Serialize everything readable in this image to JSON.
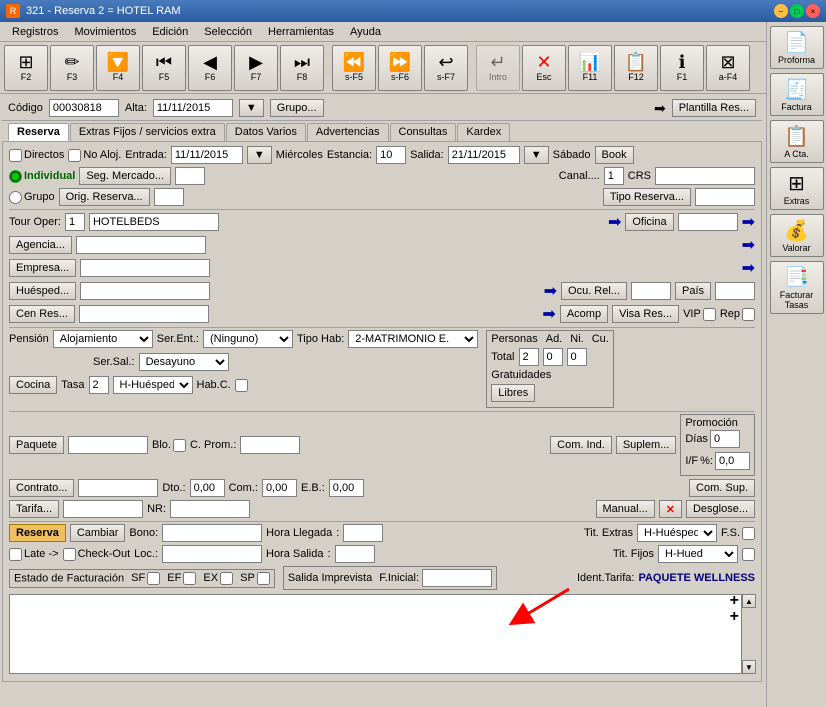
{
  "titlebar": {
    "title": "321 - Reserva   2 = HOTEL RAM",
    "icon": "R"
  },
  "menubar": {
    "items": [
      "Registros",
      "Movimientos",
      "Edición",
      "Selección",
      "Herramientas",
      "Ayuda"
    ]
  },
  "toolbar": {
    "buttons": [
      {
        "id": "F2",
        "icon": "⊞",
        "label": "F2"
      },
      {
        "id": "F3",
        "icon": "✏",
        "label": "F3"
      },
      {
        "id": "F4",
        "icon": "▼",
        "label": "F4"
      },
      {
        "id": "F5",
        "icon": "◀",
        "label": "F5"
      },
      {
        "id": "F6",
        "icon": "◀",
        "label": "F6"
      },
      {
        "id": "F7",
        "icon": "▶",
        "label": "F7"
      },
      {
        "id": "F8",
        "icon": "▶▶",
        "label": "F8"
      },
      {
        "id": "s-F5",
        "icon": "◀|",
        "label": "s-F5"
      },
      {
        "id": "s-F6",
        "icon": "|◀",
        "label": "s-F6"
      },
      {
        "id": "s-F7",
        "icon": "↵",
        "label": "s-F7"
      },
      {
        "id": "Intro",
        "icon": "↩",
        "label": "Intro"
      },
      {
        "id": "Esc",
        "icon": "✕",
        "label": "Esc"
      },
      {
        "id": "F11",
        "icon": "⊟",
        "label": "F11"
      },
      {
        "id": "F12",
        "icon": "⊞",
        "label": "F12"
      },
      {
        "id": "F1",
        "icon": "ℹ",
        "label": "F1"
      },
      {
        "id": "a-F4",
        "icon": "⊠",
        "label": "a-F4"
      }
    ]
  },
  "codebar": {
    "codigo_label": "Código",
    "codigo_value": "00030818",
    "alta_label": "Alta:",
    "alta_value": "11/11/2015",
    "grupo_label": "Grupo...",
    "plantilla_label": "Plantilla Res..."
  },
  "tabs": {
    "items": [
      "Reserva",
      "Extras Fijos / servicios extra",
      "Datos Varios",
      "Advertencias",
      "Consultas",
      "Kardex"
    ],
    "active": 0
  },
  "reservation": {
    "directos_label": "Directos",
    "no_aloj_label": "No Aloj.",
    "entrada_label": "Entrada:",
    "entrada_value": "11/11/2015",
    "miercoles_label": "Miércoles",
    "estancia_label": "Estancia:",
    "estancia_value": "10",
    "salida_label": "Salida:",
    "salida_value": "21/11/2015",
    "sabado_label": "Sábado",
    "book_label": "Book",
    "individual_label": "Individual",
    "grupo_label": "Grupo",
    "seg_mercado_label": "Seg. Mercado...",
    "orig_reserva_label": "Orig. Reserva...",
    "canal_label": "Canal....",
    "canal_value": "1",
    "crs_label": "CRS",
    "tipo_reserva_label": "Tipo Reserva...",
    "tour_oper_label": "Tour Oper:",
    "tour_oper_value": "1",
    "hotelbeds_label": "HOTELBEDS",
    "agencia_label": "Agencia...",
    "empresa_label": "Empresa...",
    "huesped_label": "Huésped...",
    "ocu_rel_label": "Ocu. Rel...",
    "pais_label": "País",
    "cen_res_label": "Cen Res...",
    "acomp_label": "Acomp",
    "visa_res_label": "Visa Res...",
    "vip_label": "VIP",
    "rep_label": "Rep",
    "pension_label": "Pensión",
    "pension_value": "Alojamiento",
    "ser_ent_label": "Ser.Ent.:",
    "ser_ent_value": "(Ninguno)",
    "tipo_hab_label": "Tipo Hab:",
    "tipo_hab_value": "2-MATRIMONIO E.",
    "personas_label": "Personas",
    "ad_label": "Ad.",
    "ni_label": "Ni.",
    "cu_label": "Cu.",
    "total_label": "Total",
    "ad_value": "2",
    "ni_value": "0",
    "cu_value": "0",
    "gratuidades_label": "Gratuidades",
    "ser_sal_label": "Ser.Sal.:",
    "ser_sal_value": "Desayuno",
    "libres_label": "Libres",
    "cocina_label": "Cocina",
    "tasa_label": "Tasa",
    "tasa_value": "2",
    "h_huesped_label": "H-Huésped",
    "hab_c_label": "Hab.C.",
    "paquete_label": "Paquete",
    "blo_label": "Blo.",
    "c_prom_label": "C. Prom.:",
    "com_ind_label": "Com. Ind.",
    "suplem_label": "Suplem...",
    "contrato_label": "Contrato...",
    "dto_label": "Dto.:",
    "dto_value": "0,00",
    "com_label": "Com.:",
    "com_value": "0,00",
    "eb_label": "E.B.:",
    "eb_value": "0,00",
    "com_sup_label": "Com. Sup.",
    "manual_label": "Manual...",
    "tarifa_label": "Tarifa...",
    "nr_label": "NR:",
    "desglose_label": "Desglose...",
    "promocion_label": "Promoción",
    "dias_label": "Días",
    "dias_value": "0",
    "if_label": "I/F",
    "pct_label": "%:",
    "pct_value": "0,0",
    "reserva_btn": "Reserva",
    "cambiar_btn": "Cambiar",
    "bono_label": "Bono:",
    "hora_llegada_label": "Hora Llegada",
    "hora_salida_label": "Hora Salida",
    "tit_extras_label": "Tit. Extras",
    "h_huesped2_label": "H-Huésped",
    "fs_label": "F.S.",
    "tit_fijos_label": "Tit. Fijos",
    "h_hued_label": "H-Hued",
    "late_label": "Late ->",
    "check_out_label": "Check-Out",
    "loc_label": "Loc.:",
    "estado_facturacion_label": "Estado de Facturación",
    "sf_label": "SF",
    "ef_label": "EF",
    "ex_label": "EX",
    "sp_label": "SP",
    "salida_imprevista_label": "Salida Imprevista",
    "f_inicial_label": "F.Inicial:",
    "ident_tarifa_label": "Ident.Tarifa:",
    "ident_tarifa_value": "PAQUETE WELLNESS"
  },
  "right_panel": {
    "buttons": [
      {
        "id": "proforma",
        "icon": "📄",
        "label": "Proforma"
      },
      {
        "id": "factura",
        "icon": "🧾",
        "label": "Factura"
      },
      {
        "id": "acta",
        "icon": "📋",
        "label": "A Cta."
      },
      {
        "id": "extras",
        "icon": "⊞",
        "label": "Extras"
      },
      {
        "id": "valorar",
        "icon": "💰",
        "label": "Valorar"
      },
      {
        "id": "facturar_tasas",
        "icon": "📑",
        "label": "Facturar Tasas"
      }
    ]
  },
  "oficina_label": "Oficina"
}
